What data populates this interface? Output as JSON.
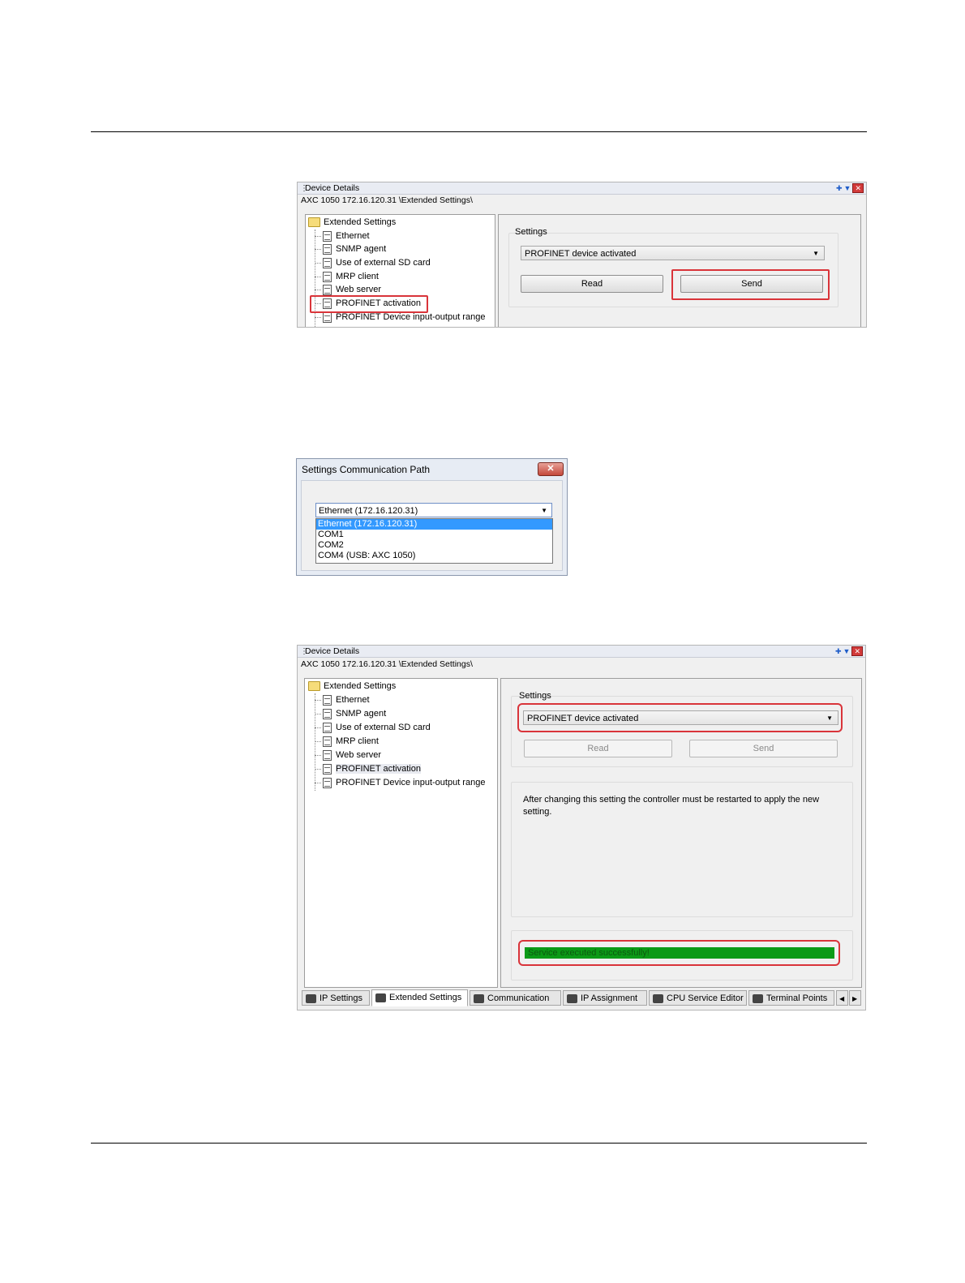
{
  "screen1": {
    "title": "Device Details",
    "path": "AXC 1050 172.16.120.31 \\Extended Settings\\",
    "tree_root": "Extended Settings",
    "tree_items": [
      "Ethernet",
      "SNMP agent",
      "Use of external SD card",
      "MRP client",
      "Web server",
      "PROFINET activation",
      "PROFINET Device input-output range"
    ],
    "settings_label": "Settings",
    "combo_value": "PROFINET device activated",
    "read_label": "Read",
    "send_label": "Send"
  },
  "dialog": {
    "title": "Settings Communication Path",
    "close_label": "✕",
    "combo_value": "Ethernet (172.16.120.31)",
    "options": [
      "Ethernet (172.16.120.31)",
      "COM1",
      "COM2",
      "COM4 (USB: AXC 1050)"
    ]
  },
  "screen2": {
    "title": "Device Details",
    "path": "AXC 1050 172.16.120.31 \\Extended Settings\\",
    "tree_root": "Extended Settings",
    "tree_items": [
      "Ethernet",
      "SNMP agent",
      "Use of external SD card",
      "MRP client",
      "Web server",
      "PROFINET activation",
      "PROFINET Device input-output range"
    ],
    "settings_label": "Settings",
    "combo_value": "PROFINET device activated",
    "read_label": "Read",
    "send_label": "Send",
    "info_text": "After changing this setting the controller must be restarted to apply the new setting.",
    "status_text": "Service executed successfully!",
    "tabs": [
      "IP Settings",
      "Extended Settings",
      "Communication",
      "IP Assignment",
      "CPU Service Editor",
      "Terminal Points"
    ]
  },
  "colors": {
    "highlight_red": "#d9343a",
    "status_green": "#0b9a17",
    "selection_blue": "#3399ff"
  }
}
